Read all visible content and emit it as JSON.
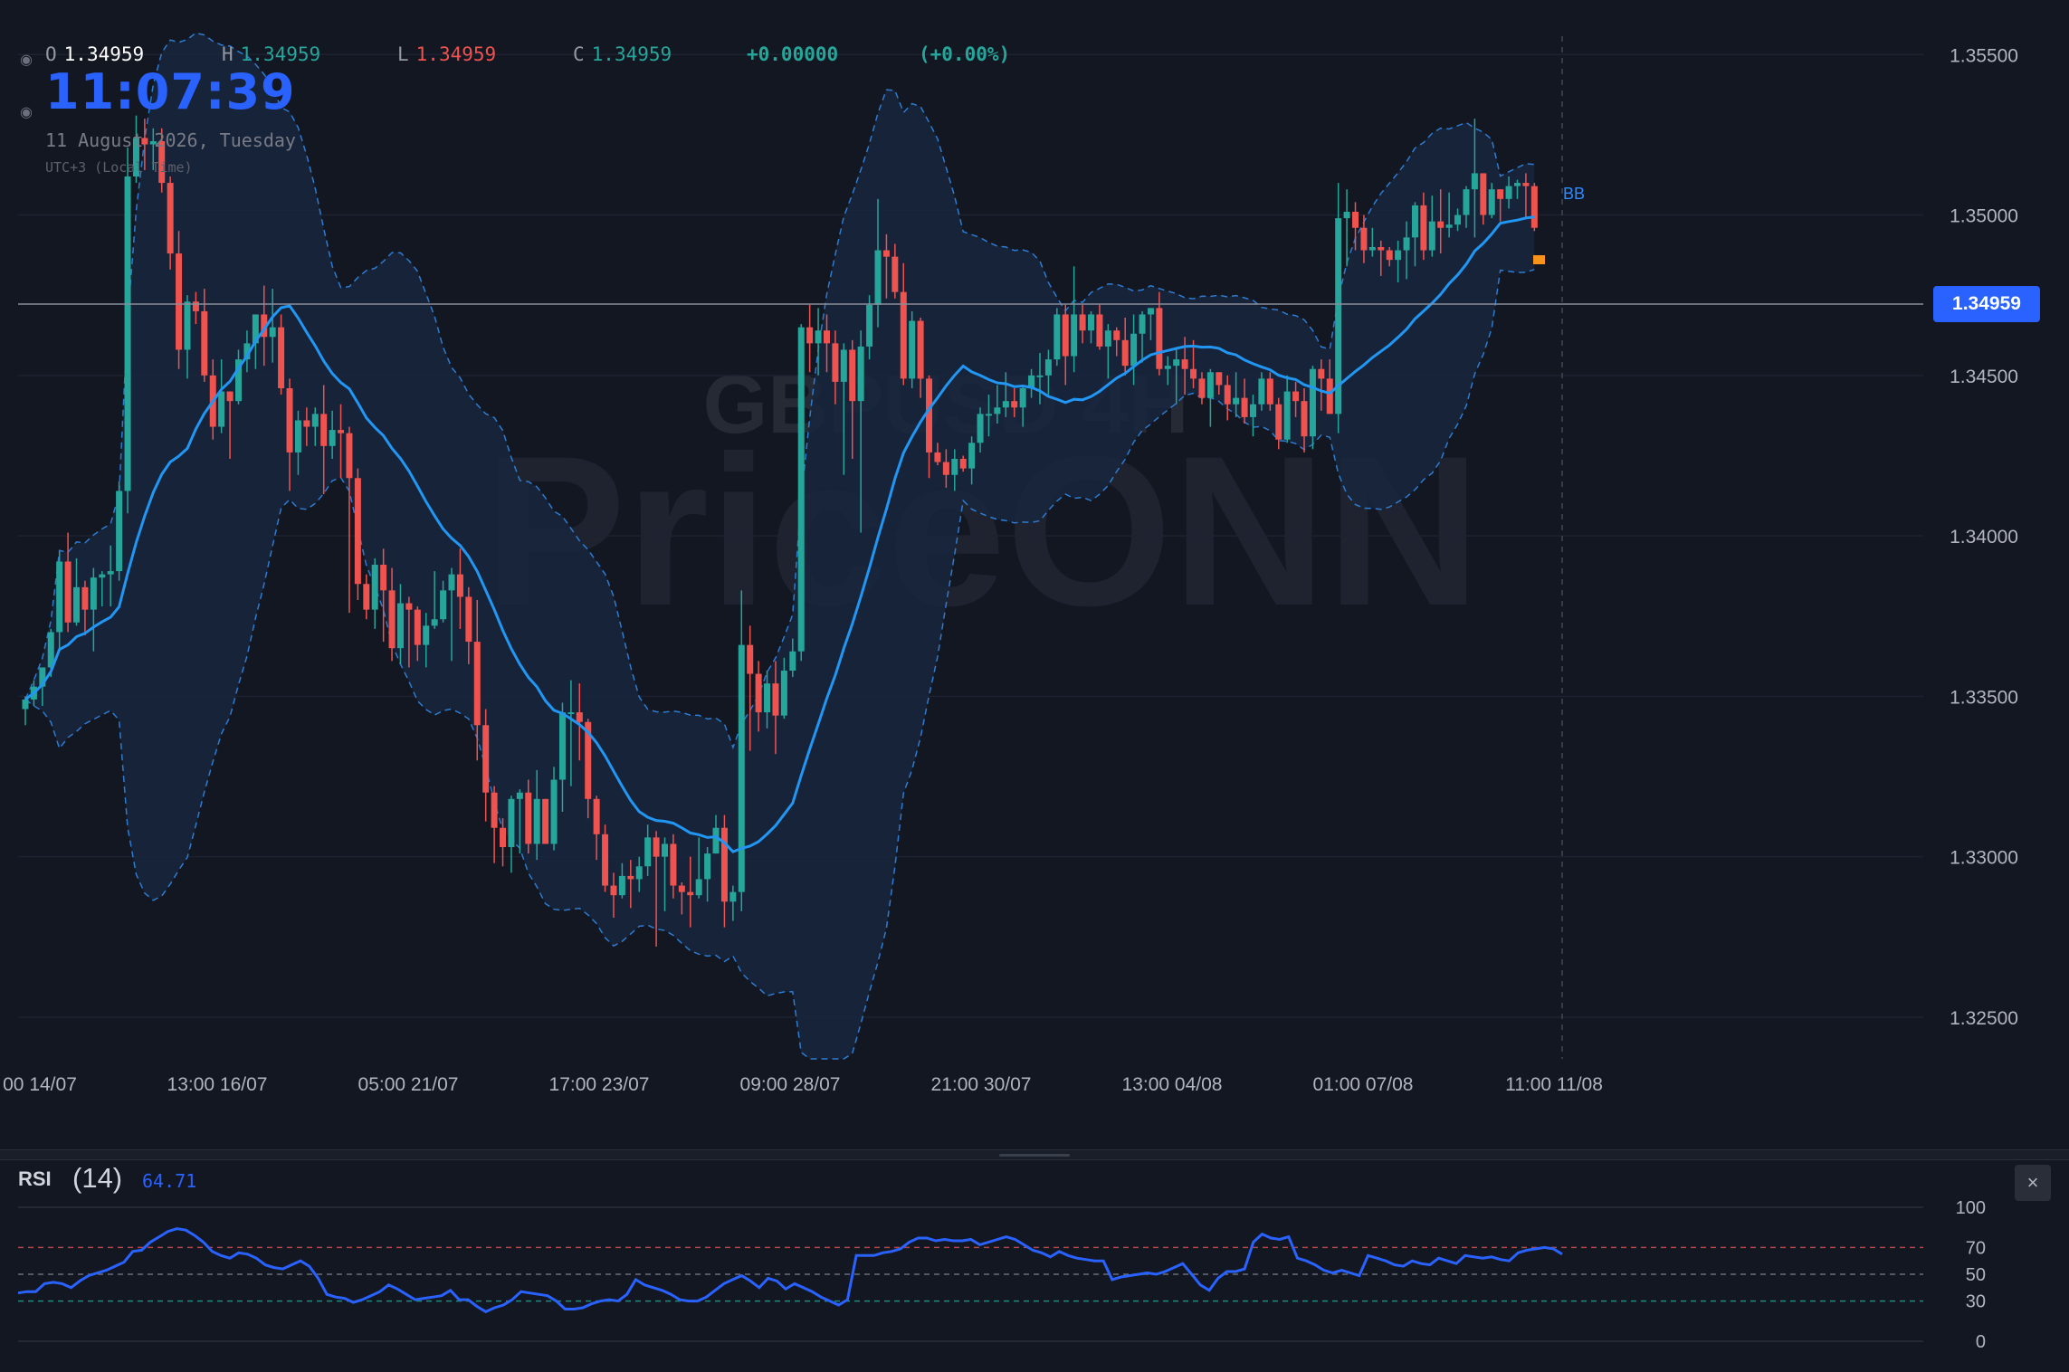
{
  "legend": {
    "open_label": "O",
    "open": "1.34959",
    "high_label": "H",
    "high": "1.34959",
    "low_label": "L",
    "low": "1.34959",
    "close_label": "C",
    "close": "1.34959",
    "change": "+0.00000",
    "change_pct": "(+0.00%)"
  },
  "clock": {
    "time": "11:07:39",
    "date": "11 August 2026, Tuesday",
    "timezone": "UTC+3 (Local Time)"
  },
  "watermark": {
    "symbol": "GBPUSD 4H",
    "brand": "PriceONN"
  },
  "colors": {
    "up": "#26a69a",
    "down": "#ef5350",
    "ma": "#2196f3",
    "band_fill": "#17263d",
    "band_line": "#2e7bcf",
    "rsi": "#2962ff",
    "accent": "#2962ff",
    "bg": "#131722"
  },
  "price_tag": "1.34959",
  "bb_label": "BB",
  "rsi": {
    "title": "RSI",
    "period": "(14)",
    "value": "64.71",
    "levels": [
      100,
      70,
      50,
      30,
      0
    ]
  },
  "close_icon_glyph": "×",
  "chart_data": {
    "type": "candlestick",
    "timeframe": "4H",
    "y_axis": {
      "ticks": [
        "1.35500",
        "1.35000",
        "1.34500",
        "1.34000",
        "1.33500",
        "1.33000",
        "1.32500"
      ],
      "range": [
        1.3237,
        1.3567
      ]
    },
    "x_axis": {
      "labels": [
        "00 14/07",
        "13:00 16/07",
        "05:00 21/07",
        "17:00 23/07",
        "09:00 28/07",
        "21:00 30/07",
        "13:00 04/08",
        "01:00 07/08",
        "11:00 11/08"
      ]
    },
    "current_price": 1.34959,
    "candles": [
      [
        1.3346,
        1.3349,
        1.3341,
        1.335
      ],
      [
        1.3349,
        1.3353,
        1.3347,
        1.3355
      ],
      [
        1.3353,
        1.3359,
        1.3347,
        1.3357
      ],
      [
        1.3359,
        1.337,
        1.3356,
        1.3371
      ],
      [
        1.337,
        1.3392,
        1.3365,
        1.3395
      ],
      [
        1.3392,
        1.3373,
        1.337,
        1.3401
      ],
      [
        1.3373,
        1.3384,
        1.3372,
        1.3393
      ],
      [
        1.3384,
        1.3377,
        1.3369,
        1.3386
      ],
      [
        1.3377,
        1.3387,
        1.3364,
        1.339
      ],
      [
        1.3387,
        1.3388,
        1.3378,
        1.3389
      ],
      [
        1.3388,
        1.3389,
        1.3378,
        1.3397
      ],
      [
        1.3389,
        1.3414,
        1.3386,
        1.3417
      ],
      [
        1.3414,
        1.3512,
        1.3407,
        1.3521
      ],
      [
        1.3512,
        1.3524,
        1.351,
        1.3531
      ],
      [
        1.3524,
        1.3522,
        1.3514,
        1.353
      ],
      [
        1.3522,
        1.3523,
        1.3514,
        1.3527
      ],
      [
        1.3523,
        1.351,
        1.3507,
        1.3527
      ],
      [
        1.351,
        1.3488,
        1.3483,
        1.3512
      ],
      [
        1.3488,
        1.3458,
        1.3452,
        1.3495
      ],
      [
        1.3458,
        1.3473,
        1.3449,
        1.3475
      ],
      [
        1.3473,
        1.347,
        1.3466,
        1.3476
      ],
      [
        1.347,
        1.345,
        1.3448,
        1.3477
      ],
      [
        1.345,
        1.3434,
        1.343,
        1.3455
      ],
      [
        1.3434,
        1.3445,
        1.3432,
        1.3455
      ],
      [
        1.3445,
        1.3442,
        1.3424,
        1.3445
      ],
      [
        1.3442,
        1.3455,
        1.3441,
        1.3458
      ],
      [
        1.3455,
        1.346,
        1.3451,
        1.3464
      ],
      [
        1.346,
        1.3469,
        1.3452,
        1.3469
      ],
      [
        1.3469,
        1.3462,
        1.3453,
        1.3478
      ],
      [
        1.3462,
        1.3465,
        1.3454,
        1.3477
      ],
      [
        1.3465,
        1.3446,
        1.3444,
        1.3469
      ],
      [
        1.3446,
        1.3426,
        1.3414,
        1.3449
      ],
      [
        1.3426,
        1.3436,
        1.3419,
        1.3439
      ],
      [
        1.3436,
        1.3434,
        1.3428,
        1.344
      ],
      [
        1.3434,
        1.3438,
        1.3428,
        1.344
      ],
      [
        1.3438,
        1.3428,
        1.3413,
        1.3447
      ],
      [
        1.3428,
        1.3433,
        1.3424,
        1.3439
      ],
      [
        1.3433,
        1.3432,
        1.3418,
        1.3441
      ],
      [
        1.3432,
        1.3418,
        1.3376,
        1.3434
      ],
      [
        1.3418,
        1.3385,
        1.338,
        1.3421
      ],
      [
        1.3385,
        1.3377,
        1.3374,
        1.3388
      ],
      [
        1.3377,
        1.3391,
        1.3371,
        1.3393
      ],
      [
        1.3391,
        1.3383,
        1.3367,
        1.3396
      ],
      [
        1.3383,
        1.3365,
        1.3361,
        1.339
      ],
      [
        1.3365,
        1.3379,
        1.336,
        1.3385
      ],
      [
        1.3379,
        1.3377,
        1.3359,
        1.3381
      ],
      [
        1.3377,
        1.3366,
        1.3361,
        1.3378
      ],
      [
        1.3366,
        1.3372,
        1.3359,
        1.3376
      ],
      [
        1.3372,
        1.3374,
        1.3371,
        1.3389
      ],
      [
        1.3374,
        1.3383,
        1.3373,
        1.3386
      ],
      [
        1.3383,
        1.3388,
        1.3361,
        1.339
      ],
      [
        1.3388,
        1.3381,
        1.3371,
        1.3396
      ],
      [
        1.3381,
        1.3367,
        1.336,
        1.3384
      ],
      [
        1.3367,
        1.3341,
        1.333,
        1.338
      ],
      [
        1.3341,
        1.332,
        1.3311,
        1.3346
      ],
      [
        1.332,
        1.3309,
        1.3298,
        1.3322
      ],
      [
        1.3309,
        1.3303,
        1.3297,
        1.3312
      ],
      [
        1.3303,
        1.3318,
        1.3295,
        1.3319
      ],
      [
        1.3318,
        1.332,
        1.3301,
        1.3321
      ],
      [
        1.332,
        1.3304,
        1.3301,
        1.3324
      ],
      [
        1.3304,
        1.3318,
        1.3299,
        1.3327
      ],
      [
        1.3318,
        1.3304,
        1.3304,
        1.3318
      ],
      [
        1.3304,
        1.3324,
        1.3302,
        1.3328
      ],
      [
        1.3324,
        1.3345,
        1.3314,
        1.3348
      ],
      [
        1.3345,
        1.3345,
        1.3322,
        1.3355
      ],
      [
        1.3345,
        1.3342,
        1.333,
        1.3354
      ],
      [
        1.3342,
        1.3318,
        1.3312,
        1.3343
      ],
      [
        1.3318,
        1.3307,
        1.3299,
        1.3319
      ],
      [
        1.3307,
        1.3291,
        1.3289,
        1.331
      ],
      [
        1.3291,
        1.3288,
        1.3281,
        1.3295
      ],
      [
        1.3288,
        1.3294,
        1.3287,
        1.3298
      ],
      [
        1.3294,
        1.3293,
        1.3284,
        1.3299
      ],
      [
        1.3293,
        1.3297,
        1.3289,
        1.33
      ],
      [
        1.3297,
        1.3306,
        1.3294,
        1.331
      ],
      [
        1.3306,
        1.33,
        1.3272,
        1.3308
      ],
      [
        1.33,
        1.3304,
        1.3283,
        1.3306
      ],
      [
        1.3304,
        1.3291,
        1.3287,
        1.3307
      ],
      [
        1.3291,
        1.3289,
        1.3282,
        1.3292
      ],
      [
        1.3289,
        1.3288,
        1.3278,
        1.33
      ],
      [
        1.3288,
        1.3293,
        1.3287,
        1.3306
      ],
      [
        1.3293,
        1.3301,
        1.3286,
        1.3303
      ],
      [
        1.3301,
        1.3309,
        1.3301,
        1.3313
      ],
      [
        1.3309,
        1.3286,
        1.3278,
        1.3313
      ],
      [
        1.3286,
        1.3289,
        1.328,
        1.3291
      ],
      [
        1.3289,
        1.3366,
        1.3283,
        1.3383
      ],
      [
        1.3366,
        1.3357,
        1.3333,
        1.3372
      ],
      [
        1.3357,
        1.3345,
        1.3339,
        1.3361
      ],
      [
        1.3345,
        1.3354,
        1.334,
        1.3358
      ],
      [
        1.3354,
        1.3344,
        1.3332,
        1.3361
      ],
      [
        1.3344,
        1.3358,
        1.3343,
        1.3362
      ],
      [
        1.3358,
        1.3364,
        1.3356,
        1.3368
      ],
      [
        1.3364,
        1.3465,
        1.3361,
        1.3466
      ],
      [
        1.3465,
        1.346,
        1.3451,
        1.3472
      ],
      [
        1.346,
        1.3464,
        1.345,
        1.3471
      ],
      [
        1.3464,
        1.346,
        1.3451,
        1.3469
      ],
      [
        1.346,
        1.3448,
        1.3441,
        1.3464
      ],
      [
        1.3448,
        1.3458,
        1.3419,
        1.346
      ],
      [
        1.3458,
        1.3442,
        1.3424,
        1.3461
      ],
      [
        1.3442,
        1.3459,
        1.3401,
        1.3464
      ],
      [
        1.3459,
        1.3472,
        1.3455,
        1.3475
      ],
      [
        1.3472,
        1.3489,
        1.3465,
        1.3505
      ],
      [
        1.3489,
        1.3487,
        1.3474,
        1.3494
      ],
      [
        1.3487,
        1.3476,
        1.3474,
        1.3491
      ],
      [
        1.3476,
        1.3449,
        1.3447,
        1.3485
      ],
      [
        1.3449,
        1.3467,
        1.3446,
        1.347
      ],
      [
        1.3467,
        1.3449,
        1.3443,
        1.3468
      ],
      [
        1.3449,
        1.3426,
        1.3418,
        1.345
      ],
      [
        1.3426,
        1.3423,
        1.3422,
        1.3429
      ],
      [
        1.3423,
        1.3419,
        1.3415,
        1.3427
      ],
      [
        1.3419,
        1.3424,
        1.3414,
        1.3427
      ],
      [
        1.3424,
        1.3421,
        1.342,
        1.3425
      ],
      [
        1.3421,
        1.3429,
        1.3416,
        1.3431
      ],
      [
        1.3429,
        1.3438,
        1.3426,
        1.344
      ],
      [
        1.3438,
        1.3438,
        1.3431,
        1.3444
      ],
      [
        1.3438,
        1.344,
        1.3435,
        1.3447
      ],
      [
        1.344,
        1.3442,
        1.3437,
        1.3451
      ],
      [
        1.3442,
        1.344,
        1.3437,
        1.3446
      ],
      [
        1.344,
        1.3446,
        1.3434,
        1.3447
      ],
      [
        1.3446,
        1.345,
        1.3443,
        1.3452
      ],
      [
        1.345,
        1.345,
        1.3441,
        1.3457
      ],
      [
        1.345,
        1.3455,
        1.3444,
        1.3458
      ],
      [
        1.3455,
        1.3469,
        1.3453,
        1.3471
      ],
      [
        1.3469,
        1.3456,
        1.3447,
        1.3472
      ],
      [
        1.3456,
        1.3469,
        1.3451,
        1.3484
      ],
      [
        1.3469,
        1.3464,
        1.346,
        1.3472
      ],
      [
        1.3464,
        1.3469,
        1.346,
        1.347
      ],
      [
        1.3469,
        1.3459,
        1.3458,
        1.3472
      ],
      [
        1.3459,
        1.3464,
        1.3449,
        1.3466
      ],
      [
        1.3464,
        1.3461,
        1.3456,
        1.3465
      ],
      [
        1.3461,
        1.3453,
        1.345,
        1.3468
      ],
      [
        1.3453,
        1.3463,
        1.3447,
        1.3469
      ],
      [
        1.3463,
        1.3469,
        1.3454,
        1.347
      ],
      [
        1.3469,
        1.3471,
        1.3461,
        1.3471
      ],
      [
        1.3471,
        1.3452,
        1.345,
        1.3476
      ],
      [
        1.3452,
        1.3453,
        1.3447,
        1.3456
      ],
      [
        1.3453,
        1.3455,
        1.3441,
        1.3458
      ],
      [
        1.3455,
        1.3452,
        1.3444,
        1.3462
      ],
      [
        1.3452,
        1.3449,
        1.3446,
        1.3461
      ],
      [
        1.3449,
        1.3443,
        1.3441,
        1.3451
      ],
      [
        1.3443,
        1.3451,
        1.3434,
        1.3452
      ],
      [
        1.3451,
        1.3447,
        1.3444,
        1.3451
      ],
      [
        1.3447,
        1.3441,
        1.3436,
        1.345
      ],
      [
        1.3441,
        1.3443,
        1.3437,
        1.3451
      ],
      [
        1.3443,
        1.3437,
        1.3435,
        1.3449
      ],
      [
        1.3437,
        1.3441,
        1.3431,
        1.3444
      ],
      [
        1.3441,
        1.3449,
        1.3439,
        1.3451
      ],
      [
        1.3449,
        1.3441,
        1.3439,
        1.3451
      ],
      [
        1.3441,
        1.343,
        1.3427,
        1.3443
      ],
      [
        1.343,
        1.3445,
        1.3429,
        1.345
      ],
      [
        1.3445,
        1.3442,
        1.3437,
        1.3448
      ],
      [
        1.3442,
        1.3431,
        1.3426,
        1.3446
      ],
      [
        1.3431,
        1.3452,
        1.3427,
        1.3453
      ],
      [
        1.3452,
        1.3449,
        1.3439,
        1.3455
      ],
      [
        1.3449,
        1.3438,
        1.3438,
        1.3455
      ],
      [
        1.3438,
        1.3499,
        1.3432,
        1.351
      ],
      [
        1.3499,
        1.3501,
        1.3484,
        1.3508
      ],
      [
        1.3501,
        1.3496,
        1.3489,
        1.3504
      ],
      [
        1.3496,
        1.3489,
        1.3485,
        1.35
      ],
      [
        1.3489,
        1.349,
        1.3487,
        1.3496
      ],
      [
        1.349,
        1.3489,
        1.3481,
        1.3492
      ],
      [
        1.3489,
        1.3486,
        1.3484,
        1.349
      ],
      [
        1.3486,
        1.3489,
        1.3479,
        1.3492
      ],
      [
        1.3489,
        1.3493,
        1.348,
        1.3498
      ],
      [
        1.3493,
        1.3503,
        1.3484,
        1.3504
      ],
      [
        1.3503,
        1.3489,
        1.3486,
        1.3507
      ],
      [
        1.3489,
        1.3498,
        1.3487,
        1.3506
      ],
      [
        1.3498,
        1.3496,
        1.3488,
        1.3508
      ],
      [
        1.3496,
        1.3497,
        1.3493,
        1.3507
      ],
      [
        1.3497,
        1.35,
        1.3495,
        1.3502
      ],
      [
        1.35,
        1.3508,
        1.3496,
        1.3509
      ],
      [
        1.3508,
        1.3513,
        1.3493,
        1.353
      ],
      [
        1.3513,
        1.35,
        1.3497,
        1.3513
      ],
      [
        1.35,
        1.3508,
        1.3499,
        1.351
      ],
      [
        1.3508,
        1.3505,
        1.3498,
        1.3508
      ],
      [
        1.3505,
        1.3509,
        1.3502,
        1.3512
      ],
      [
        1.3509,
        1.351,
        1.3505,
        1.3511
      ],
      [
        1.351,
        1.3509,
        1.3499,
        1.3513
      ],
      [
        1.3509,
        1.3496,
        1.3495,
        1.351
      ]
    ],
    "indicators": [
      "Bollinger Bands (20, 2)",
      "Moving average (20)"
    ],
    "rsi": {
      "period": 14,
      "range": [
        0,
        100
      ],
      "levels": [
        70,
        50,
        30
      ],
      "values": [
        36,
        37,
        37,
        43,
        44,
        43,
        40,
        45,
        49,
        51,
        53,
        56,
        59,
        67,
        68,
        74,
        78,
        82,
        84,
        83,
        79,
        74,
        67,
        64,
        62,
        66,
        65,
        62,
        57,
        55,
        54,
        57,
        60,
        56,
        47,
        35,
        33,
        32,
        29,
        31,
        34,
        37,
        42,
        39,
        35,
        31,
        32,
        33,
        34,
        38,
        31,
        31,
        26,
        22,
        25,
        27,
        31,
        37,
        36,
        35,
        34,
        30,
        24,
        24,
        25,
        28,
        30,
        31,
        30,
        35,
        46,
        42,
        40,
        38,
        35,
        31,
        30,
        30,
        33,
        38,
        43,
        46,
        49,
        45,
        40,
        47,
        45,
        39,
        43,
        40,
        37,
        33,
        30,
        27,
        31,
        64,
        64,
        64,
        66,
        67,
        69,
        74,
        77,
        77,
        75,
        76,
        75,
        75,
        76,
        72,
        74,
        76,
        78,
        76,
        72,
        68,
        66,
        63,
        67,
        64,
        62,
        61,
        60,
        60,
        46,
        48,
        49,
        50,
        51,
        50,
        52,
        55,
        58,
        50,
        42,
        38,
        47,
        52,
        52,
        54,
        74,
        80,
        77,
        76,
        78,
        62,
        60,
        57,
        53,
        51,
        53,
        51,
        49,
        64,
        62,
        60,
        57,
        56,
        60,
        58,
        57,
        62,
        60,
        58,
        64,
        63,
        62,
        63,
        61,
        60,
        66,
        68,
        69,
        70,
        69,
        65
      ]
    }
  }
}
